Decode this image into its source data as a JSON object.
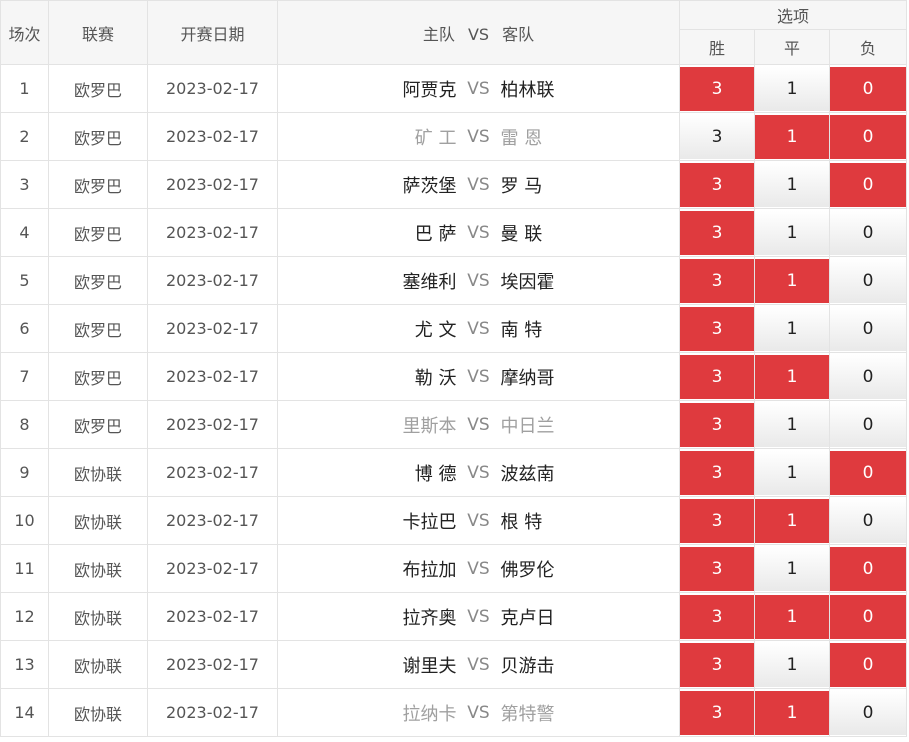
{
  "header": {
    "col_index": "场次",
    "col_league": "联赛",
    "col_date": "开赛日期",
    "col_home": "主队",
    "col_vs": "VS",
    "col_away": "客队",
    "col_options": "选项",
    "opt_win": "胜",
    "opt_draw": "平",
    "opt_lose": "负"
  },
  "colors": {
    "selected": "#df3a3e",
    "unselected": "#f0f0f0"
  },
  "rows": [
    {
      "idx": "1",
      "league": "欧罗巴",
      "date": "2023-02-17",
      "home": "阿贾克",
      "vs": "VS",
      "away": "柏林联",
      "w": "3",
      "d": "1",
      "l": "0",
      "sel": [
        true,
        false,
        true
      ],
      "dim": false
    },
    {
      "idx": "2",
      "league": "欧罗巴",
      "date": "2023-02-17",
      "home": "矿 工",
      "vs": "VS",
      "away": "雷 恩",
      "w": "3",
      "d": "1",
      "l": "0",
      "sel": [
        false,
        true,
        true
      ],
      "dim": true
    },
    {
      "idx": "3",
      "league": "欧罗巴",
      "date": "2023-02-17",
      "home": "萨茨堡",
      "vs": "VS",
      "away": "罗 马",
      "w": "3",
      "d": "1",
      "l": "0",
      "sel": [
        true,
        false,
        true
      ],
      "dim": false
    },
    {
      "idx": "4",
      "league": "欧罗巴",
      "date": "2023-02-17",
      "home": "巴 萨",
      "vs": "VS",
      "away": "曼 联",
      "w": "3",
      "d": "1",
      "l": "0",
      "sel": [
        true,
        false,
        false
      ],
      "dim": false
    },
    {
      "idx": "5",
      "league": "欧罗巴",
      "date": "2023-02-17",
      "home": "塞维利",
      "vs": "VS",
      "away": "埃因霍",
      "w": "3",
      "d": "1",
      "l": "0",
      "sel": [
        true,
        true,
        false
      ],
      "dim": false
    },
    {
      "idx": "6",
      "league": "欧罗巴",
      "date": "2023-02-17",
      "home": "尤 文",
      "vs": "VS",
      "away": "南 特",
      "w": "3",
      "d": "1",
      "l": "0",
      "sel": [
        true,
        false,
        false
      ],
      "dim": false
    },
    {
      "idx": "7",
      "league": "欧罗巴",
      "date": "2023-02-17",
      "home": "勒 沃",
      "vs": "VS",
      "away": "摩纳哥",
      "w": "3",
      "d": "1",
      "l": "0",
      "sel": [
        true,
        true,
        false
      ],
      "dim": false
    },
    {
      "idx": "8",
      "league": "欧罗巴",
      "date": "2023-02-17",
      "home": "里斯本",
      "vs": "VS",
      "away": "中日兰",
      "w": "3",
      "d": "1",
      "l": "0",
      "sel": [
        true,
        false,
        false
      ],
      "dim": true
    },
    {
      "idx": "9",
      "league": "欧协联",
      "date": "2023-02-17",
      "home": "博 德",
      "vs": "VS",
      "away": "波兹南",
      "w": "3",
      "d": "1",
      "l": "0",
      "sel": [
        true,
        false,
        true
      ],
      "dim": false
    },
    {
      "idx": "10",
      "league": "欧协联",
      "date": "2023-02-17",
      "home": "卡拉巴",
      "vs": "VS",
      "away": "根 特",
      "w": "3",
      "d": "1",
      "l": "0",
      "sel": [
        true,
        true,
        false
      ],
      "dim": false
    },
    {
      "idx": "11",
      "league": "欧协联",
      "date": "2023-02-17",
      "home": "布拉加",
      "vs": "VS",
      "away": "佛罗伦",
      "w": "3",
      "d": "1",
      "l": "0",
      "sel": [
        true,
        false,
        true
      ],
      "dim": false
    },
    {
      "idx": "12",
      "league": "欧协联",
      "date": "2023-02-17",
      "home": "拉齐奥",
      "vs": "VS",
      "away": "克卢日",
      "w": "3",
      "d": "1",
      "l": "0",
      "sel": [
        true,
        true,
        true
      ],
      "dim": false
    },
    {
      "idx": "13",
      "league": "欧协联",
      "date": "2023-02-17",
      "home": "谢里夫",
      "vs": "VS",
      "away": "贝游击",
      "w": "3",
      "d": "1",
      "l": "0",
      "sel": [
        true,
        false,
        true
      ],
      "dim": false
    },
    {
      "idx": "14",
      "league": "欧协联",
      "date": "2023-02-17",
      "home": "拉纳卡",
      "vs": "VS",
      "away": "第特警",
      "w": "3",
      "d": "1",
      "l": "0",
      "sel": [
        true,
        true,
        false
      ],
      "dim": true
    }
  ]
}
